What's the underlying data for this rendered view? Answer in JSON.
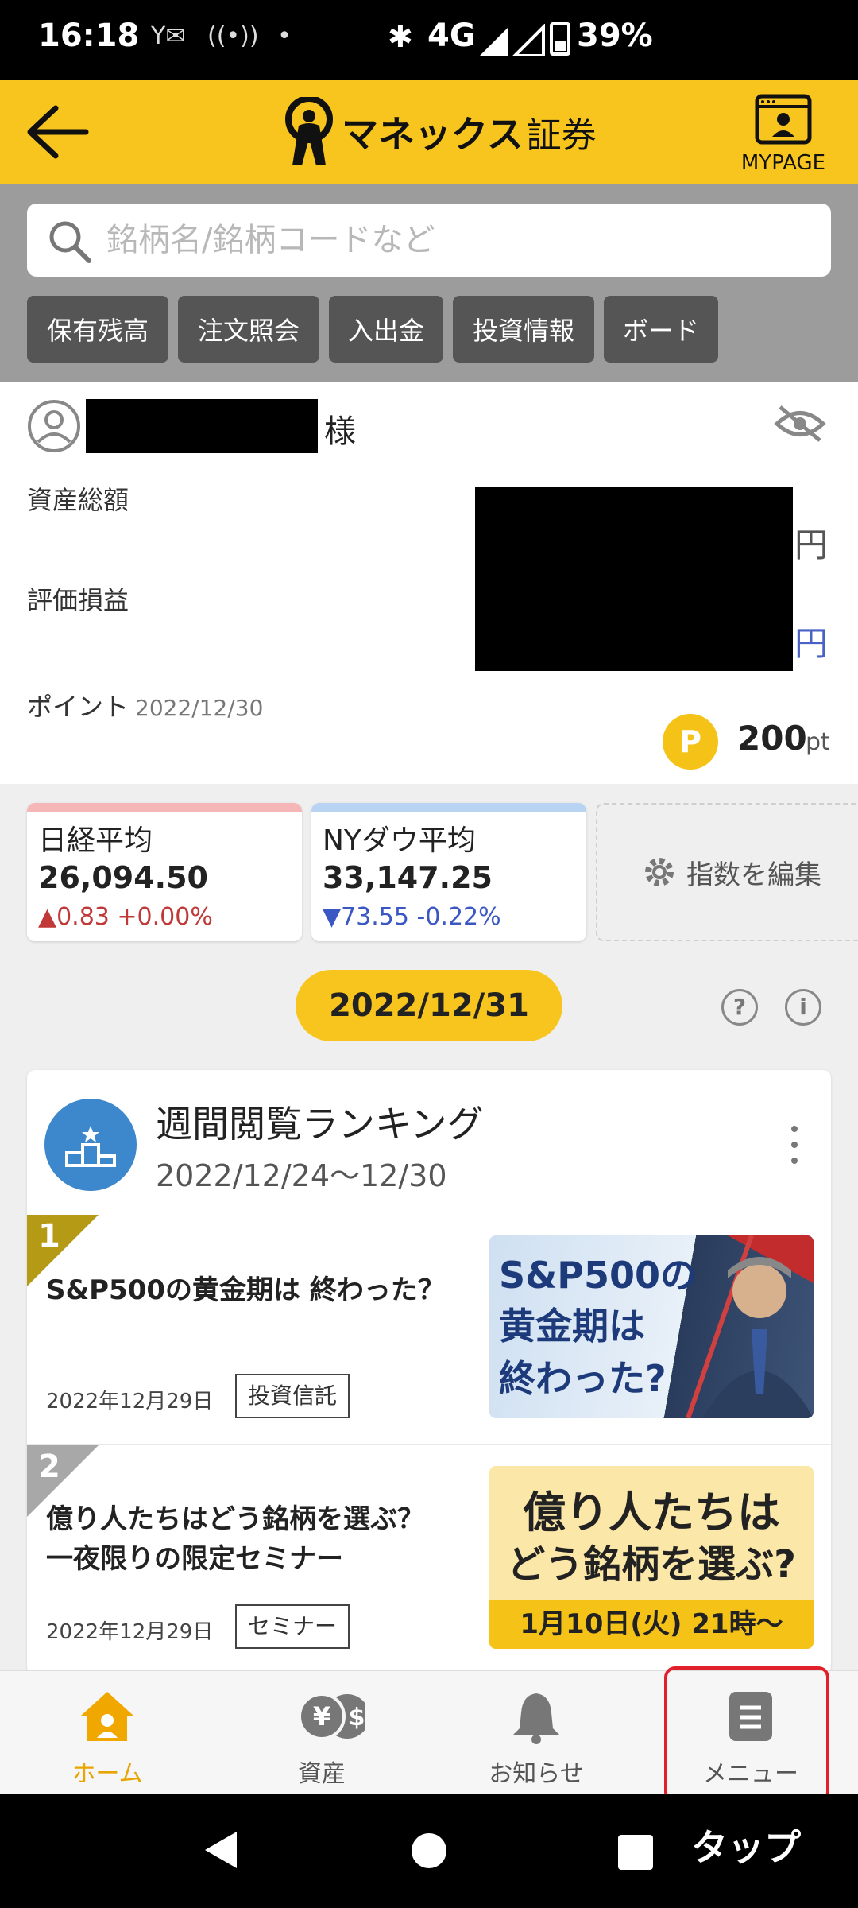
{
  "status_bar": {
    "time": "16:18",
    "network": "4G",
    "battery": "39%"
  },
  "header": {
    "brand": "マネックス",
    "brand_suffix": "証券",
    "mypage_label": "MYPAGE"
  },
  "search": {
    "placeholder": "銘柄名/銘柄コードなど"
  },
  "quick_buttons": [
    "保有残高",
    "注文照会",
    "入出金",
    "投資情報",
    "ボード"
  ],
  "account": {
    "honorific": "様",
    "total_assets_label": "資産総額",
    "pnl_label": "評価損益",
    "yen": "円",
    "points_label": "ポイント",
    "points_date": "2022/12/30",
    "points_icon": "P",
    "points_value": "200",
    "points_unit": "pt"
  },
  "indices": [
    {
      "name": "日経平均",
      "value": "26,094.50",
      "change": "▲0.83 +0.00%",
      "direction": "up",
      "accent": "#f4b6b6"
    },
    {
      "name": "NYダウ平均",
      "value": "33,147.25",
      "change": "▼73.55 -0.22%",
      "direction": "down",
      "accent": "#b9d4f3"
    }
  ],
  "edit_indices_label": "指数を編集",
  "date_pill": "2022/12/31",
  "ranking": {
    "title": "週間閲覧ランキング",
    "range": "2022/12/24〜12/30",
    "items": [
      {
        "rank": "1",
        "title": "S&P500の黄金期は 終わった？",
        "date": "2022年12月29日",
        "tag": "投資信託",
        "thumb_line1": "S&P500の",
        "thumb_line2": "黄金期は",
        "thumb_line3": "終わった?"
      },
      {
        "rank": "2",
        "title_line1": "億り人たちはどう銘柄を選ぶ？",
        "title_line2": "一夜限りの限定セミナー",
        "date": "2022年12月29日",
        "tag": "セミナー",
        "thumb_line1": "億り人たちは",
        "thumb_line2": "どう銘柄を選ぶ?",
        "thumb_banner": "1月10日(火) 21時〜"
      }
    ]
  },
  "bottom_nav": [
    {
      "label": "ホーム",
      "icon": "home-icon",
      "active": true
    },
    {
      "label": "資産",
      "icon": "assets-icon",
      "active": false
    },
    {
      "label": "お知らせ",
      "icon": "bell-icon",
      "active": false
    },
    {
      "label": "メニュー",
      "icon": "menu-icon",
      "active": false
    }
  ],
  "annotation": "タップ",
  "colors": {
    "brand_yellow": "#f7c51e",
    "up_red": "#c03838",
    "down_blue": "#3b57c4",
    "highlight_red": "#e0202a"
  }
}
